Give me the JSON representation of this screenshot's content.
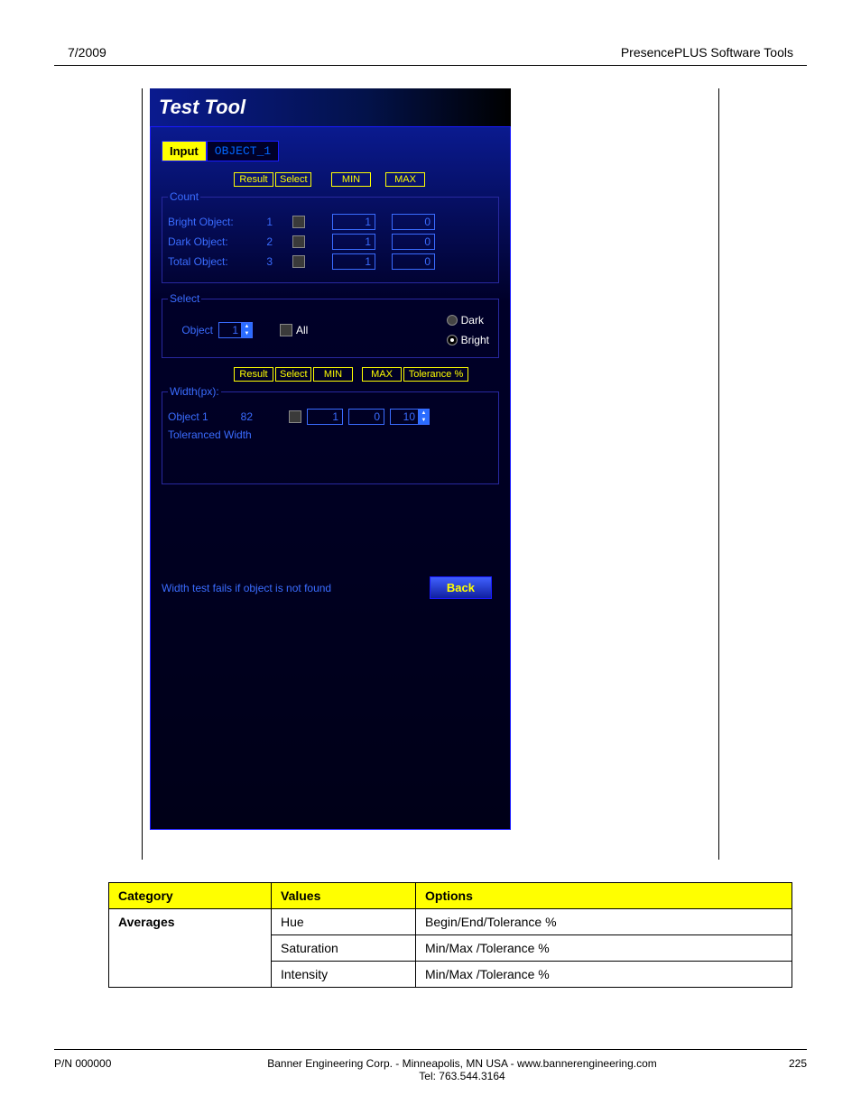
{
  "header": {
    "left": "7/2009",
    "right": "PresencePLUS Software Tools"
  },
  "tool": {
    "title": "Test Tool",
    "tabs": {
      "active": "Input",
      "inactive": "OBJECT_1"
    },
    "hdr1": {
      "result": "Result",
      "select": "Select",
      "min": "MIN",
      "max": "MAX"
    },
    "count": {
      "legend": "Count",
      "rows": [
        {
          "label": "Bright Object:",
          "result": "1",
          "min": "1",
          "max": "0"
        },
        {
          "label": "Dark Object:",
          "result": "2",
          "min": "1",
          "max": "0"
        },
        {
          "label": "Total Object:",
          "result": "3",
          "min": "1",
          "max": "0"
        }
      ]
    },
    "select": {
      "legend": "Select",
      "obj_label": "Object",
      "obj_value": "1",
      "all_label": "All",
      "radio_dark": "Dark",
      "radio_bright": "Bright"
    },
    "hdr2": {
      "result": "Result",
      "select": "Select",
      "min": "MIN",
      "max": "MAX",
      "tol": "Tolerance %"
    },
    "width": {
      "legend": "Width(px):",
      "row_label": "Object 1",
      "row_result": "82",
      "row_min": "1",
      "row_max": "0",
      "row_tol": "10",
      "toleranced": "Toleranced Width"
    },
    "status": "Width test fails if object is not found",
    "back": "Back"
  },
  "table": {
    "headers": {
      "category": "Category",
      "values": "Values",
      "options": "Options"
    },
    "category": "Averages",
    "rows": [
      {
        "value": "Hue",
        "option": "Begin/End/Tolerance %"
      },
      {
        "value": "Saturation",
        "option": "Min/Max /Tolerance %"
      },
      {
        "value": "Intensity",
        "option": "Min/Max /Tolerance %"
      }
    ]
  },
  "footer": {
    "pn": "P/N 000000",
    "company": "Banner Engineering Corp. - Minneapolis, MN USA - www.bannerengineering.com",
    "tel": "Tel: 763.544.3164",
    "page": "225"
  }
}
